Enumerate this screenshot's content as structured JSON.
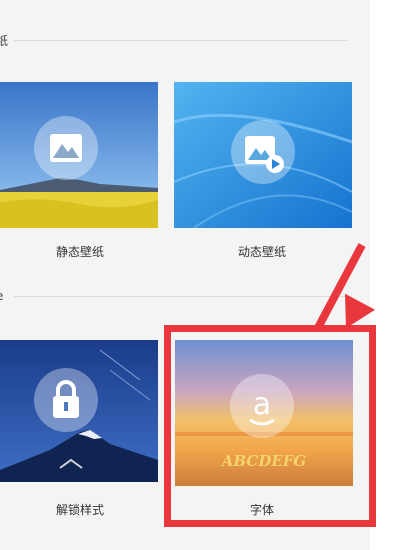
{
  "sections": {
    "wallpaper_section_label": "纸",
    "lock_section_label": "e"
  },
  "tiles": {
    "static_wallpaper": {
      "label": "静态壁纸",
      "icon": "image-icon"
    },
    "live_wallpaper": {
      "label": "动态壁纸",
      "icon": "video-image-icon"
    },
    "unlock_style": {
      "label": "解锁样式",
      "icon": "lock-icon"
    },
    "font": {
      "label": "字体",
      "icon": "font-a-icon",
      "sample_text": "ABCDEFG"
    }
  },
  "colors": {
    "highlight": "#e8383d",
    "panel_background": "#f4f4f4"
  }
}
